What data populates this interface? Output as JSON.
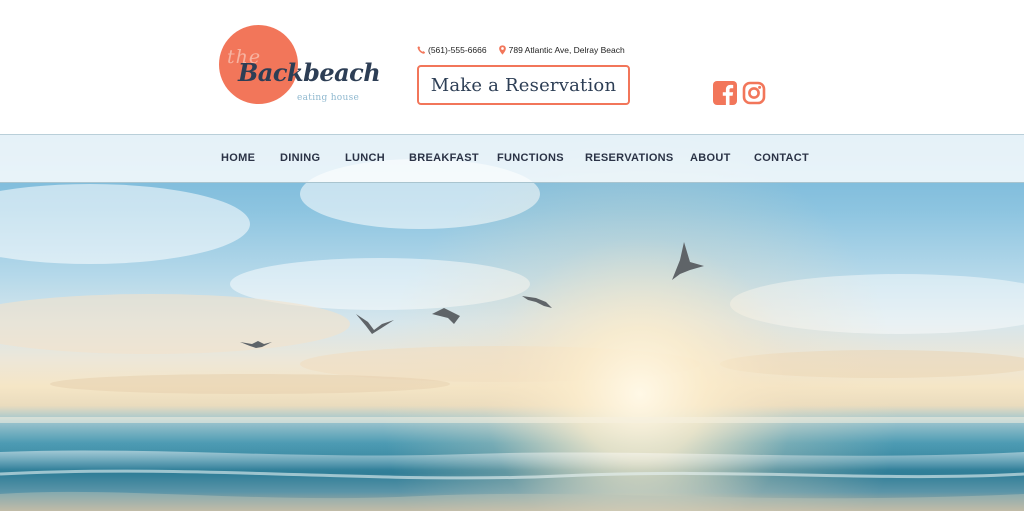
{
  "brand": {
    "logo_the": "the",
    "logo_name": "Backbeach",
    "logo_tagline": "eating house",
    "logo_color": "#f2765a",
    "logo_text_color": "#2d3e55"
  },
  "contact": {
    "phone_icon": "phone-icon",
    "phone": "(561)-555-6666",
    "location_icon": "map-pin-icon",
    "address": "789 Atlantic Ave, Delray Beach"
  },
  "reservation_button": {
    "label": "Make a Reservation"
  },
  "social": {
    "facebook_icon": "facebook-icon",
    "instagram_icon": "instagram-icon",
    "accent": "#f2765a"
  },
  "nav": {
    "items": [
      {
        "label": "HOME"
      },
      {
        "label": "DINING"
      },
      {
        "label": "LUNCH"
      },
      {
        "label": "BREAKFAST"
      },
      {
        "label": "FUNCTIONS"
      },
      {
        "label": "RESERVATIONS"
      },
      {
        "label": "ABOUT"
      },
      {
        "label": "CONTACT"
      }
    ]
  },
  "hero": {
    "image": "beach-sunrise-seagulls-photo"
  }
}
